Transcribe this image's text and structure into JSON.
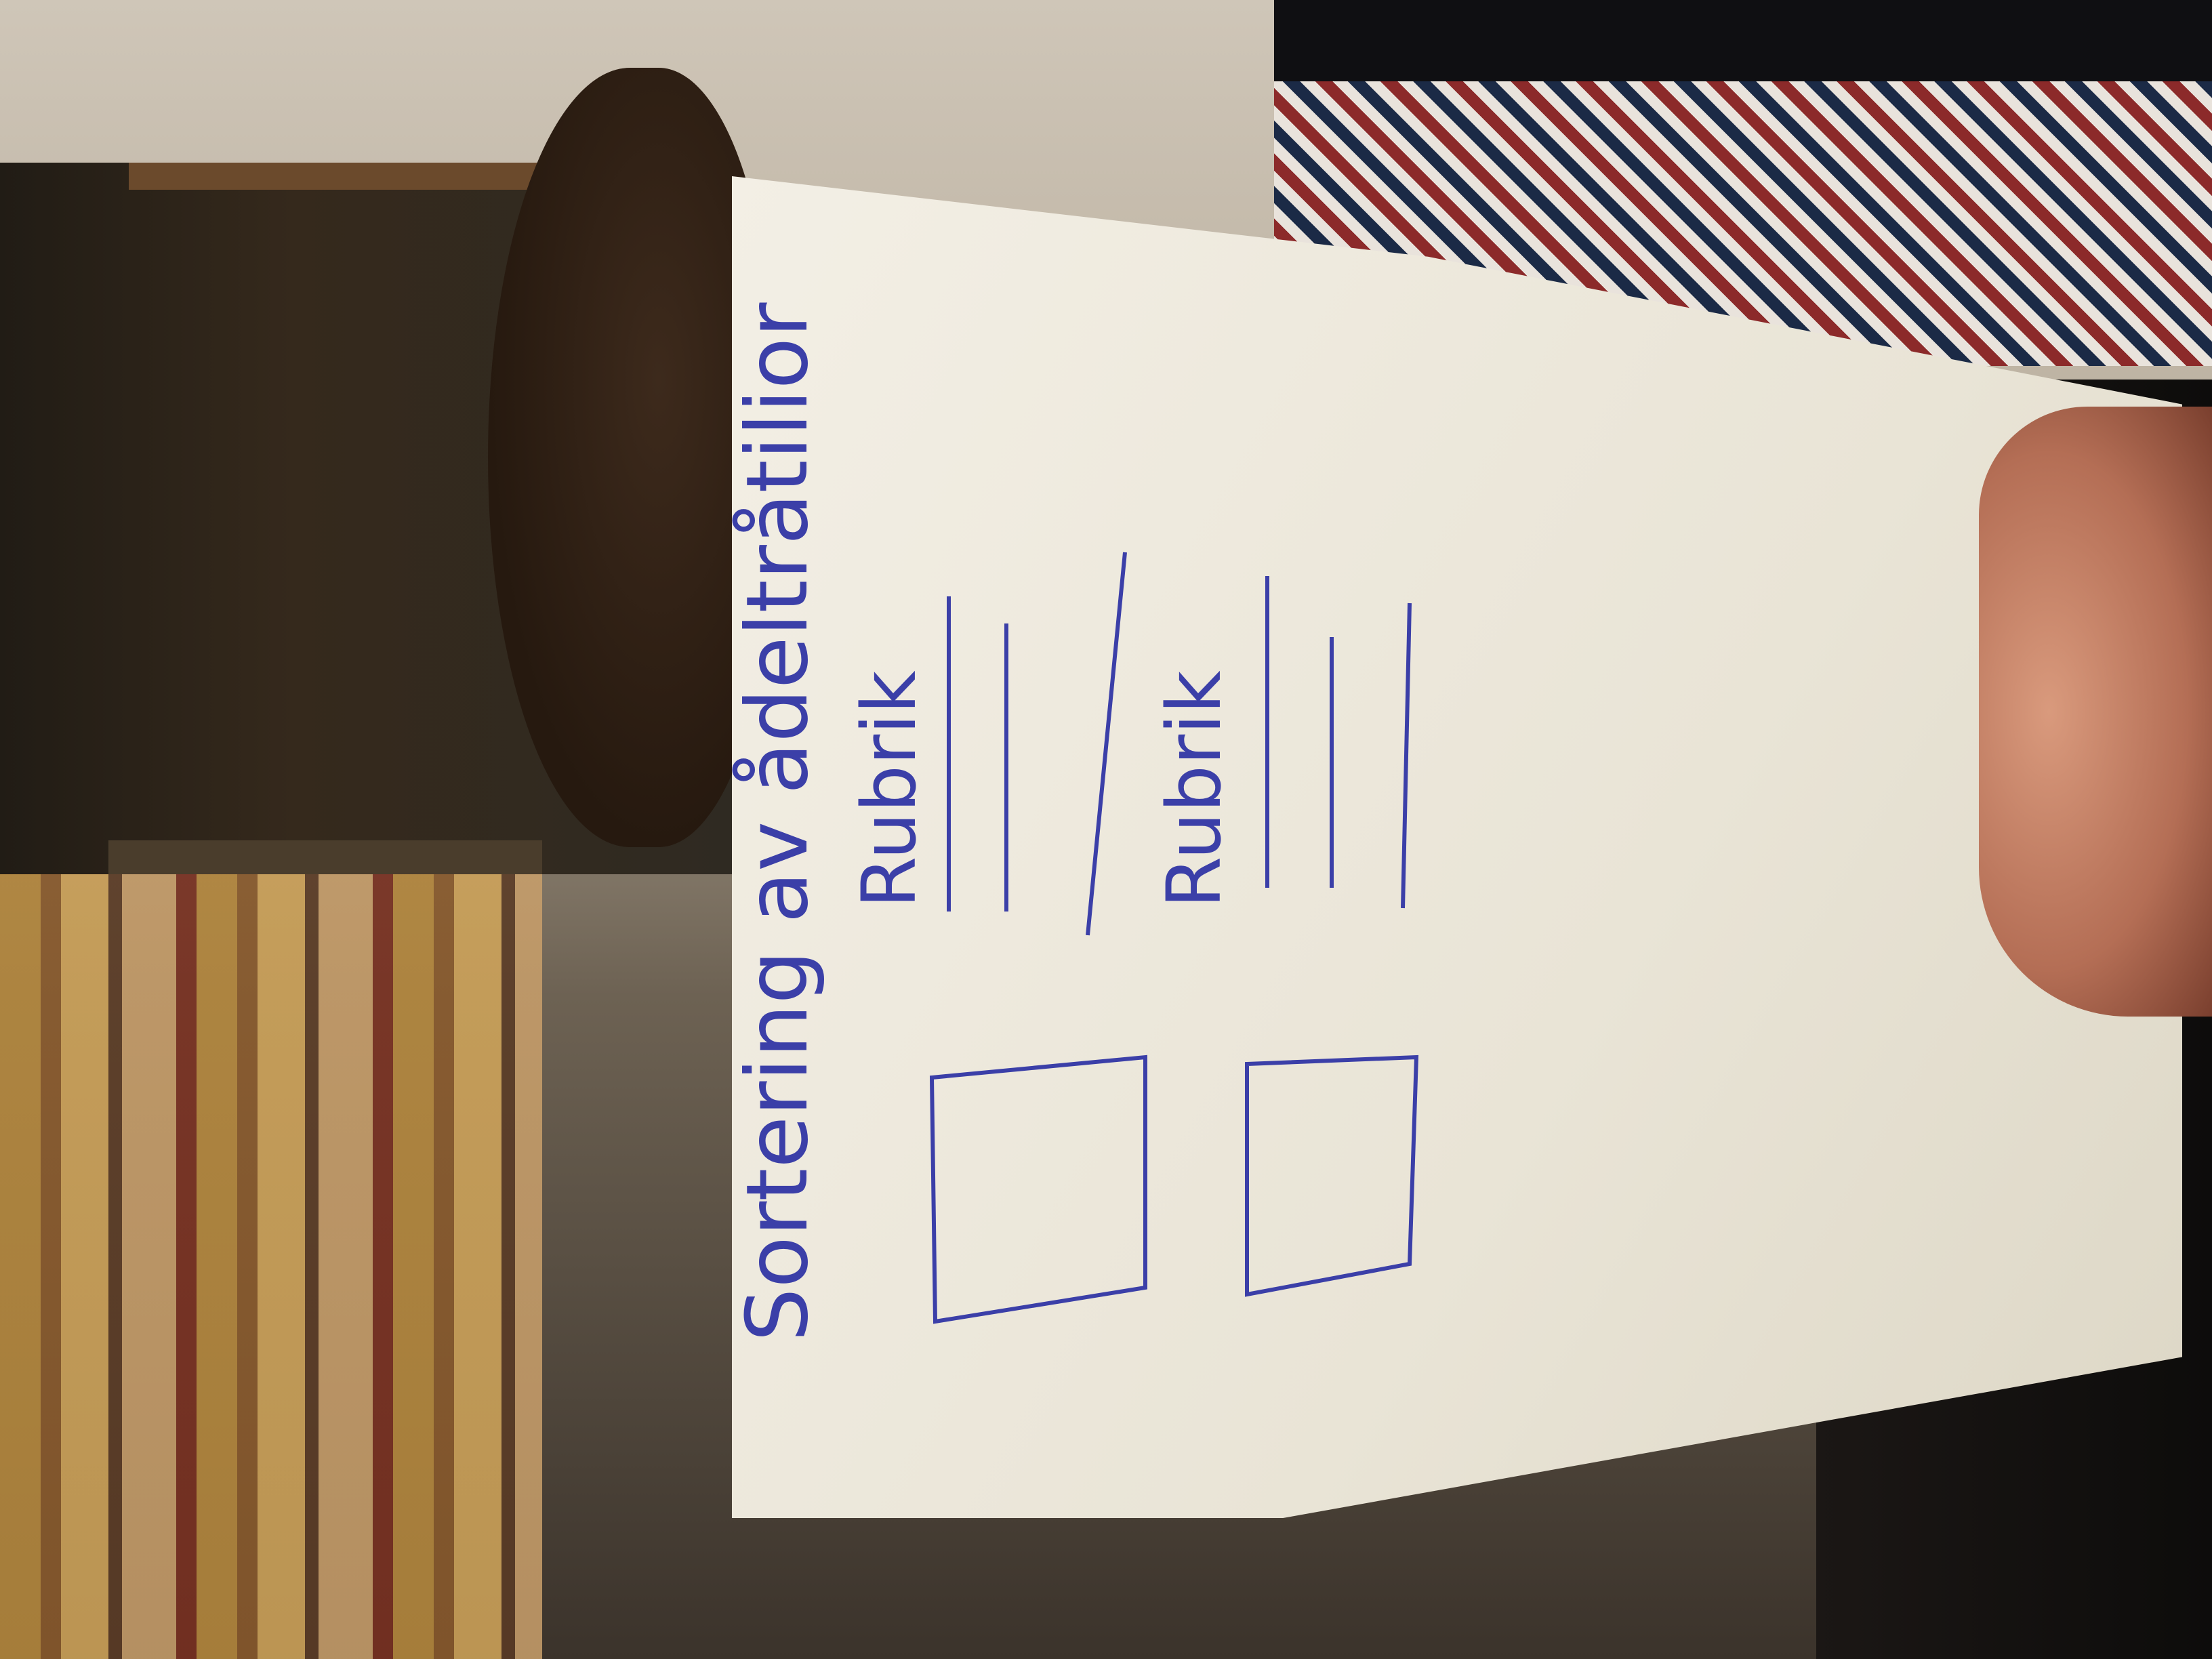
{
  "sketch": {
    "heading": "Sortering av ådeltråtilior",
    "rubrik_1": "Rubrik",
    "rubrik_2": "Rubrik",
    "ink_color": "#3b3fa8",
    "paper_color": "#efeadf"
  },
  "scene": {
    "wall_color": "#c8bfb0",
    "shelf_color": "#2b2219"
  }
}
